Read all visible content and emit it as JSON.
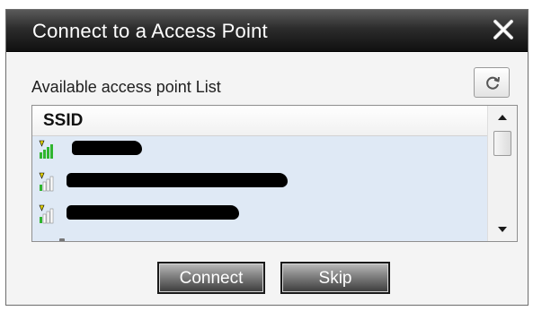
{
  "window": {
    "title": "Connect to a Access Point"
  },
  "list": {
    "label": "Available access point List",
    "column_header": "SSID",
    "rows": [
      {
        "ssid": "",
        "signal": "full",
        "redacted": true
      },
      {
        "ssid": "",
        "signal": "weak",
        "redacted": true
      },
      {
        "ssid": "",
        "signal": "weak",
        "redacted": true
      }
    ]
  },
  "buttons": {
    "connect": "Connect",
    "skip": "Skip"
  },
  "icons": {
    "close": "close-x-icon",
    "refresh": "refresh-icon",
    "signal": "signal-strength-icon",
    "scroll_up": "chevron-up-icon",
    "scroll_down": "chevron-down-icon"
  },
  "colors": {
    "titlebar": "#1e1e1e",
    "list_background": "#dfe9f5",
    "signal_green": "#2fb52f",
    "signal_yellow": "#e2d000"
  }
}
